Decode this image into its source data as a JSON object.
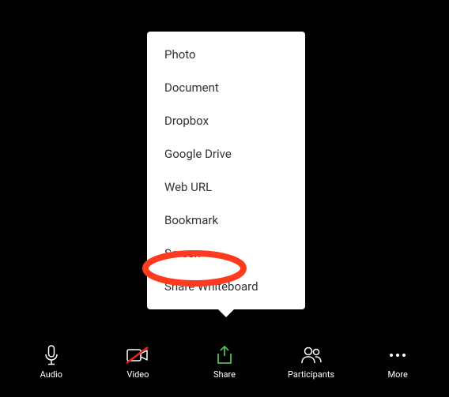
{
  "shareMenu": {
    "items": [
      {
        "label": "Photo"
      },
      {
        "label": "Document"
      },
      {
        "label": "Dropbox"
      },
      {
        "label": "Google Drive"
      },
      {
        "label": "Web URL"
      },
      {
        "label": "Bookmark"
      },
      {
        "label": "Screen"
      },
      {
        "label": "Share Whiteboard"
      }
    ]
  },
  "toolbar": {
    "audio": {
      "label": "Audio"
    },
    "video": {
      "label": "Video"
    },
    "share": {
      "label": "Share"
    },
    "participants": {
      "label": "Participants"
    },
    "more": {
      "label": "More"
    }
  },
  "colors": {
    "share_accent": "#4bbd52",
    "video_slash": "#e02828",
    "highlight": "#ff3b1f"
  }
}
